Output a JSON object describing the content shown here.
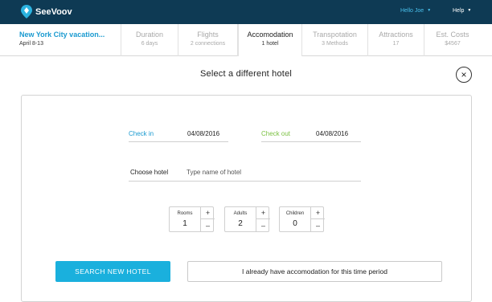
{
  "header": {
    "brand": "SeeVoov",
    "user_menu": "Hello Joe",
    "help_menu": "Help",
    "colors": {
      "bar": "#0e3a54",
      "accent": "#1ab0dd"
    }
  },
  "steps": [
    {
      "title": "New York City vacation...",
      "sub": "April 8-13"
    },
    {
      "title": "Duration",
      "sub": "6 days"
    },
    {
      "title": "Flights",
      "sub": "2 connections"
    },
    {
      "title": "Accomodation",
      "sub": "1 hotel"
    },
    {
      "title": "Transpotation",
      "sub": "3 Methods"
    },
    {
      "title": "Attractions",
      "sub": "17"
    },
    {
      "title": "Est. Costs",
      "sub": "$4567"
    }
  ],
  "page": {
    "title": "Select a different hotel",
    "close_icon": "×"
  },
  "form": {
    "checkin_label": "Check in",
    "checkin_value": "04/08/2016",
    "checkout_label": "Check out",
    "checkout_value": "04/08/2016",
    "hotel_label": "Choose hotel",
    "hotel_placeholder": "Type name of hotel",
    "hotel_value": "",
    "rooms": {
      "label": "Rooms",
      "value": "1"
    },
    "adults": {
      "label": "Adults",
      "value": "2"
    },
    "children": {
      "label": "Children",
      "value": "0"
    },
    "plus": "+",
    "minus": "–",
    "search_label": "SEARCH NEW HOTEL",
    "already_label": "I already have accomodation for this time period"
  }
}
